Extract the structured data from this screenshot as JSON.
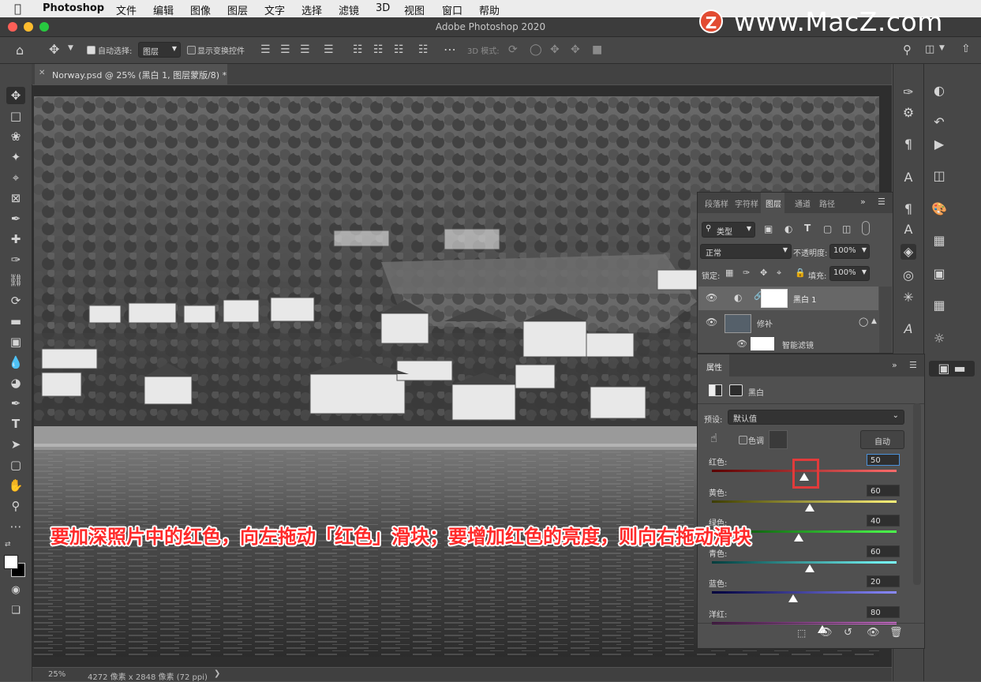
{
  "menubar": {
    "app": "Photoshop",
    "items": [
      "文件",
      "编辑",
      "图像",
      "图层",
      "文字",
      "选择",
      "滤镜",
      "3D",
      "视图",
      "窗口",
      "帮助"
    ]
  },
  "window": {
    "title": "Adobe Photoshop 2020"
  },
  "watermark": {
    "logo": "Z",
    "text": "www.MacZ.com"
  },
  "options": {
    "auto_select_label": "自动选择:",
    "auto_select_target": "图层",
    "show_transform_label": "显示变换控件",
    "mode_3d_label": "3D 模式:"
  },
  "document": {
    "tab_label": "Norway.psd @ 25% (黑白 1, 图层蒙版/8) *"
  },
  "status": {
    "zoom": "25%",
    "doc_info": "4272 像素 x 2848 像素 (72 ppi)"
  },
  "layers_panel": {
    "tabs": [
      "段落样",
      "字符样",
      "图层",
      "通道",
      "路径"
    ],
    "active_tab": "图层",
    "filter_kind": "类型",
    "blend_mode": "正常",
    "opacity_label": "不透明度:",
    "opacity_value": "100%",
    "lock_label": "锁定:",
    "fill_label": "填充:",
    "fill_value": "100%",
    "layers": [
      {
        "name": "黑白 1"
      },
      {
        "name": "修补"
      },
      {
        "name": "智能滤镜"
      }
    ]
  },
  "properties_panel": {
    "title": "属性",
    "adjustment_name": "黑白",
    "preset_label": "预设:",
    "preset_value": "默认值",
    "tint_label": "色调",
    "auto_button": "自动",
    "sliders": [
      {
        "label": "红色:",
        "value": "50",
        "position": 0.5,
        "colors": [
          "#5a0000",
          "#ff6b6b"
        ]
      },
      {
        "label": "黄色:",
        "value": "60",
        "position": 0.53,
        "colors": [
          "#3c3c00",
          "#fff37a"
        ]
      },
      {
        "label": "绿色:",
        "value": "40",
        "position": 0.47,
        "colors": [
          "#003a00",
          "#4dff4d"
        ]
      },
      {
        "label": "青色:",
        "value": "60",
        "position": 0.53,
        "colors": [
          "#003c3c",
          "#7affff"
        ]
      },
      {
        "label": "蓝色:",
        "value": "20",
        "position": 0.44,
        "colors": [
          "#00003c",
          "#8a8aff"
        ]
      },
      {
        "label": "洋红:",
        "value": "80",
        "position": 0.6,
        "colors": [
          "#3c003c",
          "#ff7aff"
        ]
      }
    ]
  },
  "caption": "要加深照片中的红色，向左拖动「红色」滑块；要增加红色的亮度，则向右拖动滑块",
  "colors": {
    "accent_highlight": "#e13b3b",
    "caption_color": "#ff2a2a"
  }
}
